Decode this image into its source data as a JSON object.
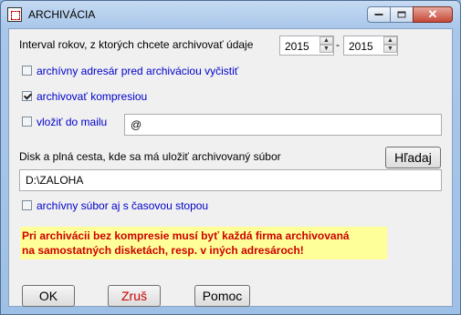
{
  "window": {
    "title": "ARCHIVÁCIA"
  },
  "interval": {
    "label": "Interval rokov, z ktorých chcete archivovať údaje",
    "from_year": "2015",
    "separator": "-",
    "to_year": "2015"
  },
  "options": {
    "clear_folder": {
      "label": "archívny adresár pred archiváciou vyčistiť",
      "checked": false
    },
    "compression": {
      "label": "archivovať kompresiou",
      "checked": true
    },
    "email": {
      "label": "vložiť do mailu",
      "checked": false,
      "value": "@"
    }
  },
  "path": {
    "label": "Disk a plná cesta, kde sa má uložiť archivovaný súbor",
    "search_label": "Hľadaj",
    "value": "D:\\ZALOHA"
  },
  "timestamp": {
    "label": "archívny súbor aj s časovou stopou",
    "checked": false
  },
  "warning": {
    "line1": "Pri archivácii bez kompresie musí byť každá firma archivovaná",
    "line2": "na samostatných disketách, resp. v iných adresároch!"
  },
  "buttons": {
    "ok": "OK",
    "cancel": "Zruš",
    "help": "Pomoc"
  },
  "colors": {
    "option_text": "#0000cc",
    "warning_text": "#cc0000",
    "warning_bg": "#ffff99",
    "cancel_text": "#cc0000"
  }
}
